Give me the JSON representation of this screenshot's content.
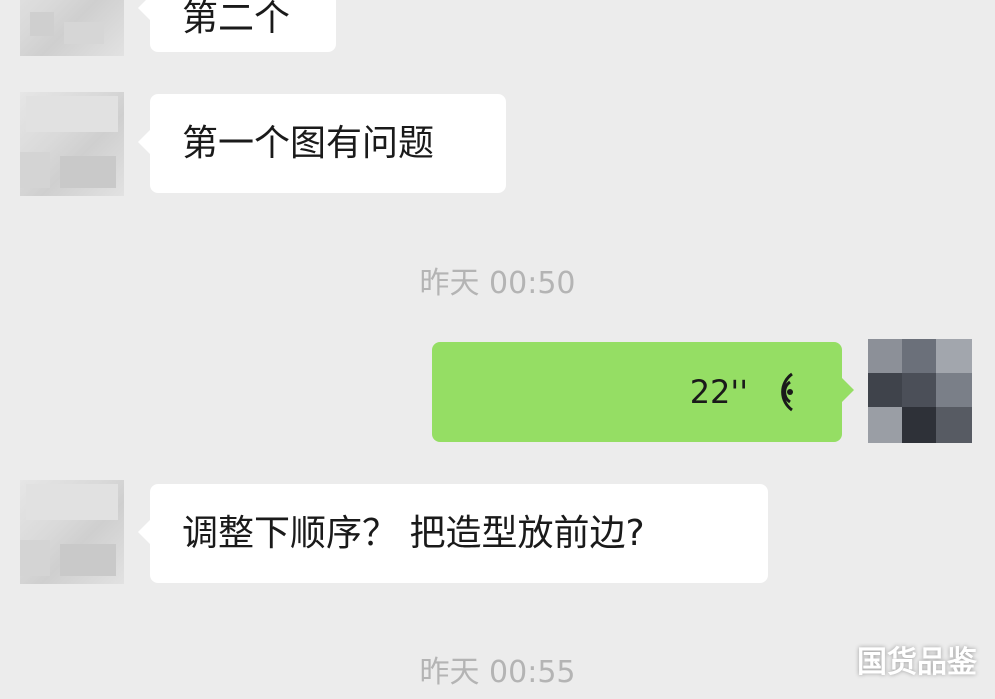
{
  "messages": [
    {
      "id": "m0",
      "side": "left",
      "text": "第二个"
    },
    {
      "id": "m1",
      "side": "left",
      "text": "第一个图有问题"
    },
    {
      "id": "t1",
      "type": "time",
      "text": "昨天 00:50"
    },
    {
      "id": "m2",
      "side": "right",
      "type": "voice",
      "duration": "22''",
      "icon": "voice-wave-icon"
    },
    {
      "id": "m3",
      "side": "left",
      "text": "调整下顺序？ 把造型放前边?"
    },
    {
      "id": "t2",
      "type": "time",
      "text": "昨天 00:55"
    }
  ],
  "watermark": "国货品鉴",
  "colors": {
    "background": "#ececec",
    "incoming_bubble": "#ffffff",
    "outgoing_bubble": "#95de64",
    "timestamp": "#b4b4b4"
  }
}
